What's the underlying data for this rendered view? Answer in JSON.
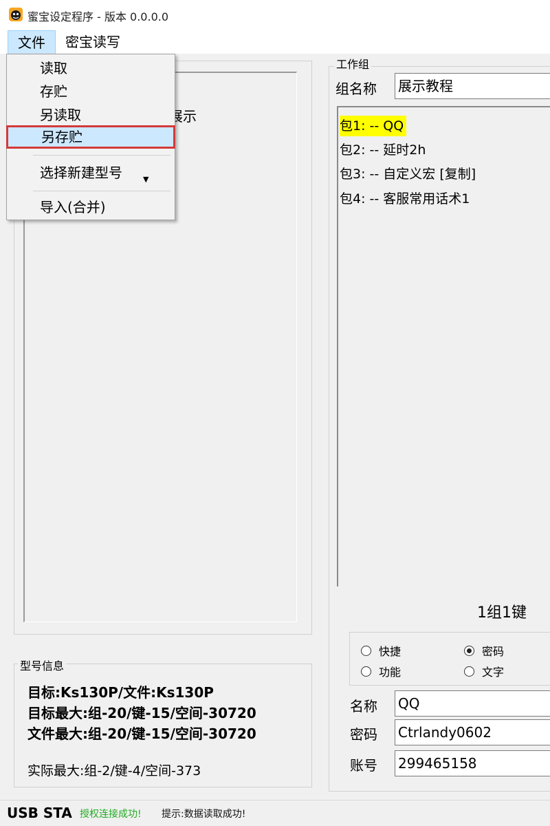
{
  "window": {
    "title": "蜜宝设定程序 - 版本 0.0.0.0"
  },
  "menubar": {
    "items": [
      "文件",
      "密宝读写"
    ]
  },
  "file_menu": {
    "items": [
      "读取",
      "存贮",
      "另读取",
      "另存贮"
    ],
    "submenu_item": "选择新建型号",
    "import_item": "导入(合并)"
  },
  "left_panel": {
    "partial_text": "展示"
  },
  "work_group": {
    "legend": "工作组",
    "group_name_label": "组名称",
    "group_name_value": "展示教程",
    "packages": [
      {
        "text": "包1: -- QQ",
        "highlighted": true
      },
      {
        "text": "包2: -- 延时2h",
        "highlighted": false
      },
      {
        "text": "包3: -- 自定义宏 [复制]",
        "highlighted": false
      },
      {
        "text": "包4: -- 客服常用话术1",
        "highlighted": false
      }
    ],
    "key_info": "1组1键",
    "radios": [
      {
        "label": "快捷",
        "checked": false
      },
      {
        "label": "密码",
        "checked": true
      },
      {
        "label": "功能",
        "checked": false
      },
      {
        "label": "文字",
        "checked": false
      }
    ],
    "fields": [
      {
        "label": "名称",
        "value": "QQ"
      },
      {
        "label": "密码",
        "value": "Ctrlandy0602"
      },
      {
        "label": "账号",
        "value": "299465158"
      }
    ]
  },
  "model_info": {
    "legend": "型号信息",
    "target": "目标:Ks130P/文件:Ks130P",
    "target_max": "目标最大:组-20/键-15/空间-30720",
    "file_max": "文件最大:组-20/键-15/空间-30720",
    "actual_max": "实际最大:组-2/键-4/空间-373"
  },
  "status": {
    "usb": "USB STA",
    "auth": "授权连接成功!",
    "hint": "提示:数据读取成功!"
  },
  "colors": {
    "highlight": "#ffff00",
    "menu_selected": "#cce8ff",
    "selection_border": "#d33a3a",
    "success_text": "#22aa22"
  }
}
